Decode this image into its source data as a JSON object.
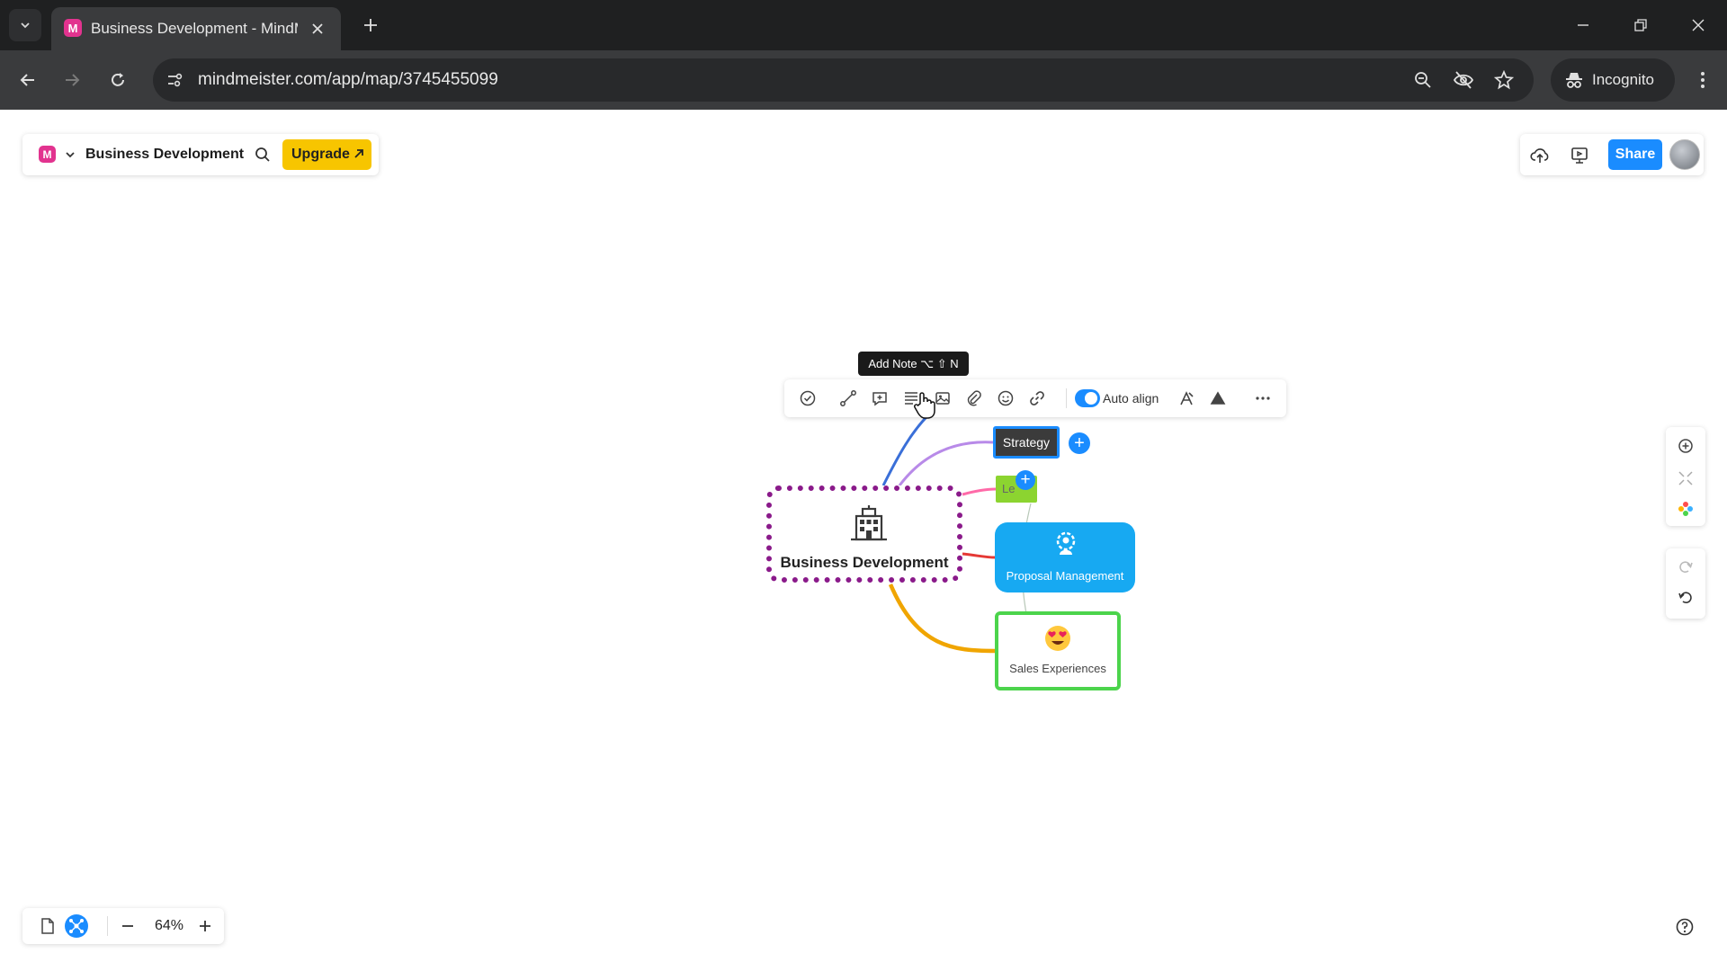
{
  "browser": {
    "tab": {
      "title": "Business Development - MindM",
      "favicon": "M"
    },
    "url": "mindmeister.com/app/map/3745455099",
    "incognito_label": "Incognito",
    "icons": [
      "tab-search-icon",
      "close-icon",
      "plus-icon",
      "minimize-icon",
      "restore-icon",
      "window-close-icon",
      "back-icon",
      "forward-icon",
      "reload-icon",
      "site-info-icon",
      "zoom-icon",
      "eye-off-icon",
      "star-icon",
      "incognito-icon",
      "more-vert-icon"
    ]
  },
  "app": {
    "logo": "M",
    "map_title": "Business Development",
    "upgrade_label": "Upgrade",
    "share_label": "Share",
    "icons": [
      "search-icon",
      "cloud-upload-icon",
      "present-icon",
      "avatar"
    ]
  },
  "toolbar": {
    "tooltip": "Add Note ⌥ ⇧ N",
    "auto_align_label": "Auto align",
    "auto_align_on": true,
    "icons": [
      "check-circle-icon",
      "connect-icon",
      "comment-icon",
      "note-icon",
      "image-icon",
      "attachment-icon",
      "emoji-icon",
      "link-icon",
      "style-icon",
      "theme-icon",
      "more-icon"
    ]
  },
  "map": {
    "root": {
      "label": "Business Development",
      "icon": "building-icon",
      "border_color": "#8a1a8a"
    },
    "children": [
      {
        "id": "strategy",
        "label": "Strategy",
        "color": "#3b3b3b",
        "selected": true
      },
      {
        "id": "legal",
        "label": "Le",
        "color": "#8cd430"
      },
      {
        "id": "proposal",
        "label": "Proposal Management",
        "icon": "person-gear-icon",
        "color": "#17a9f2"
      },
      {
        "id": "sales",
        "label": "Sales Experiences",
        "icon": "heart-eyes-emoji",
        "color": "#4cd44c"
      }
    ],
    "connector_colors": [
      "#3a6fd8",
      "#b88ae8",
      "#ff6aa8",
      "#e53935",
      "#f0a500"
    ]
  },
  "side_toolbar": {
    "icons": [
      "focus-icon",
      "collapse-icon",
      "color-palette-icon",
      "redo-icon",
      "undo-icon"
    ]
  },
  "bottom": {
    "zoom_level": "64%",
    "icons": [
      "outline-view-icon",
      "mindmap-view-icon",
      "zoom-out-icon",
      "zoom-in-icon",
      "help-icon"
    ]
  }
}
